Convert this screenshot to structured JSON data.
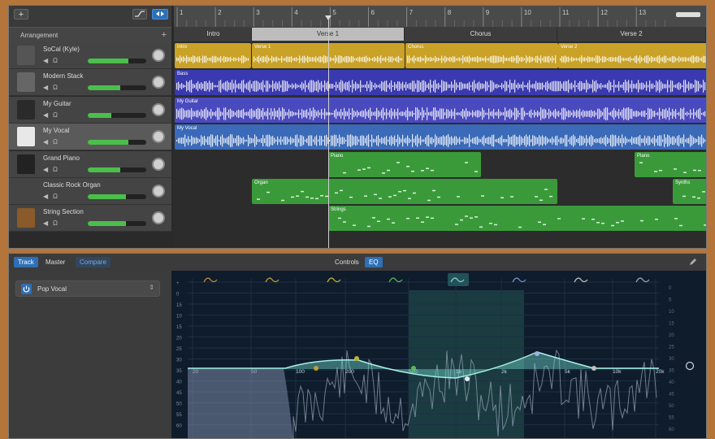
{
  "toolbar": {
    "add_label": "+"
  },
  "arrangement": {
    "label": "Arrangement",
    "add_label": "+"
  },
  "ruler": {
    "bars": [
      "1",
      "2",
      "3",
      "4",
      "5",
      "6",
      "7",
      "8",
      "9",
      "10",
      "11",
      "12",
      "13"
    ]
  },
  "sections": [
    {
      "label": "Intro",
      "active": false
    },
    {
      "label": "Verse 1",
      "active": true
    },
    {
      "label": "Chorus",
      "active": false
    },
    {
      "label": "Verse 2",
      "active": false
    }
  ],
  "tracks": [
    {
      "name": "SoCal (Kyle)",
      "volume": 0.7,
      "selected": false,
      "icon": "drums-icon"
    },
    {
      "name": "Modern Stack",
      "volume": 0.55,
      "selected": false,
      "icon": "amp-icon"
    },
    {
      "name": "My Guitar",
      "volume": 0.4,
      "selected": false,
      "icon": "guitar-amp-icon"
    },
    {
      "name": "My Vocal",
      "volume": 0.7,
      "selected": true,
      "icon": "microphone-icon"
    },
    {
      "name": "Grand Piano",
      "volume": 0.55,
      "selected": false,
      "icon": "piano-icon"
    },
    {
      "name": "Classic Rock Organ",
      "volume": 0.65,
      "selected": false,
      "icon": "organ-icon"
    },
    {
      "name": "String Section",
      "volume": 0.65,
      "selected": false,
      "icon": "strings-icon"
    }
  ],
  "regions": [
    {
      "label": "Intro",
      "lane": 0,
      "color": "#c9a227"
    },
    {
      "label": "Verse 1",
      "lane": 0,
      "color": "#c9a227"
    },
    {
      "label": "Chorus",
      "lane": 0,
      "color": "#c9a227"
    },
    {
      "label": "Verse 2",
      "lane": 0,
      "color": "#c9a227"
    },
    {
      "label": "Bass",
      "lane": 1,
      "color": "#3a3ab0"
    },
    {
      "label": "My Guitar",
      "lane": 2,
      "color": "#4a4abf"
    },
    {
      "label": "My Vocal",
      "lane": 3,
      "color": "#3a6ab8"
    },
    {
      "label": "Piano",
      "lane": 4,
      "color": "#3a9a3a"
    },
    {
      "label": "Piano",
      "lane": 4,
      "color": "#3a9a3a"
    },
    {
      "label": "Organ",
      "lane": 5,
      "color": "#3a9a3a"
    },
    {
      "label": "Synths",
      "lane": 5,
      "color": "#3a9a3a"
    },
    {
      "label": "Strings",
      "lane": 6,
      "color": "#3a9a3a"
    }
  ],
  "bottom": {
    "tabs": {
      "track": "Track",
      "master": "Master",
      "compare": "Compare"
    },
    "center_tabs": {
      "controls": "Controls",
      "eq": "EQ"
    },
    "preset": "Pop Vocal"
  },
  "eq": {
    "freq_labels": [
      "20",
      "50",
      "100",
      "200",
      "500",
      "1k",
      "2k",
      "5k",
      "10k",
      "20k"
    ],
    "db_labels": [
      "+",
      "0",
      "15",
      "10",
      "15",
      "20",
      "25",
      "30",
      "35",
      "40",
      "45",
      "50",
      "55",
      "60"
    ],
    "right_db_labels": [
      "0",
      "5",
      "10",
      "15",
      "20",
      "25",
      "30",
      "35",
      "40",
      "45",
      "50",
      "55",
      "60"
    ]
  },
  "colors": {
    "accent": "#3d8ee0",
    "green": "#4bbf4b",
    "gold": "#c9a227"
  }
}
